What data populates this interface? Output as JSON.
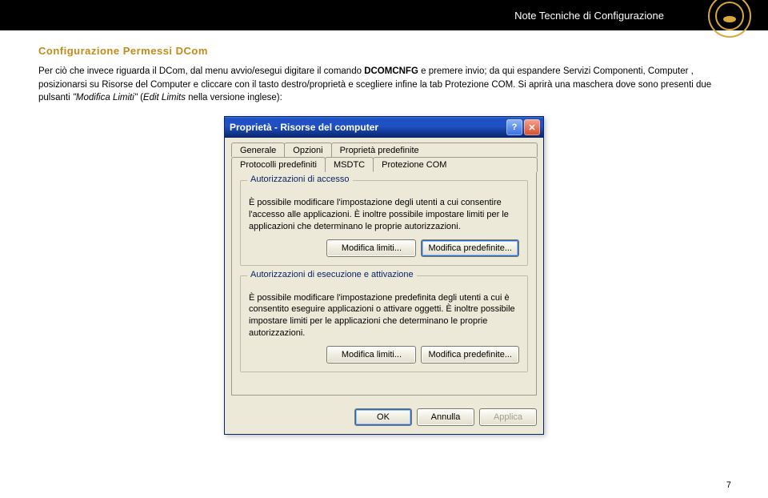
{
  "header": {
    "title": "Note Tecniche di Configurazione"
  },
  "section": {
    "heading": "Configurazione Permessi DCom",
    "para_a": "Per ciò che invece riguarda il DCom, dal menu avvio/esegui digitare il comando ",
    "cmd": "DCOMCNFG",
    "para_b": " e premere invio; da qui espandere Servizi Componenti, Computer , posizionarsi su Risorse del Computer e cliccare con il tasto destro/proprietà e scegliere infine la tab Protezione COM. Si aprirà una maschera dove sono presenti due pulsanti ",
    "quote": "\"Modifica Limiti\"",
    "para_c": " (",
    "eng": "Edit Limits",
    "para_d": " nella versione inglese):"
  },
  "dialog": {
    "title": "Proprietà - Risorse del computer",
    "help_glyph": "?",
    "close_glyph": "✕",
    "tabs_row1": {
      "t1": "Generale",
      "t2": "Opzioni",
      "t3": "Proprietà predefinite"
    },
    "tabs_row2": {
      "t1": "Protocolli predefiniti",
      "t2": "MSDTC",
      "t3": "Protezione COM"
    },
    "group1": {
      "legend": "Autorizzazioni di accesso",
      "text": "È possibile modificare l'impostazione degli utenti a cui consentire l'accesso alle applicazioni. È inoltre possibile impostare limiti per le applicazioni che determinano le proprie autorizzazioni.",
      "btn1": "Modifica limiti...",
      "btn2": "Modifica predefinite..."
    },
    "group2": {
      "legend": "Autorizzazioni di esecuzione e attivazione",
      "text": "È possibile modificare l'impostazione predefinita degli utenti a cui è consentito eseguire applicazioni o attivare oggetti. È inoltre possibile impostare limiti per le applicazioni che determinano le proprie autorizzazioni.",
      "btn1": "Modifica limiti...",
      "btn2": "Modifica predefinite..."
    },
    "footer": {
      "ok": "OK",
      "cancel": "Annulla",
      "apply": "Applica"
    }
  },
  "page_number": "7"
}
